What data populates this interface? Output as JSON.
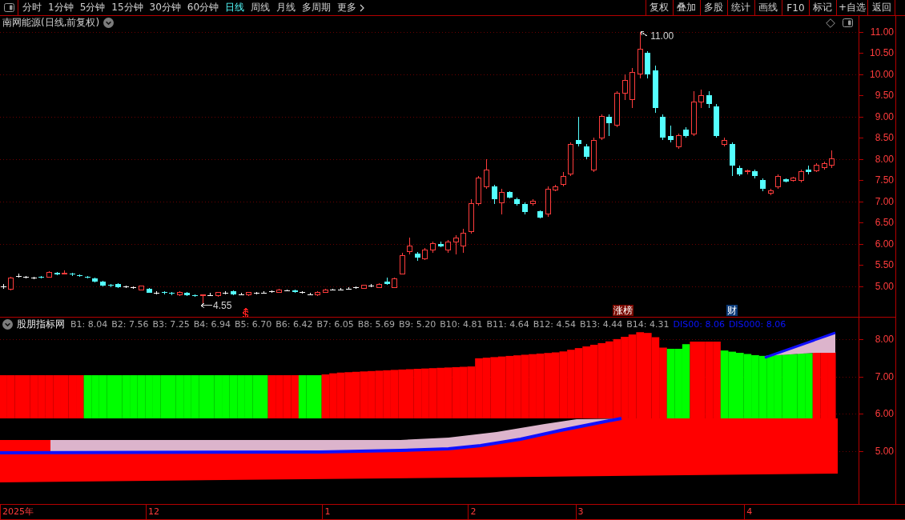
{
  "toolbar": {
    "periods": [
      {
        "label": "分时",
        "selected": false
      },
      {
        "label": "1分钟",
        "selected": false
      },
      {
        "label": "5分钟",
        "selected": false
      },
      {
        "label": "15分钟",
        "selected": false
      },
      {
        "label": "30分钟",
        "selected": false
      },
      {
        "label": "60分钟",
        "selected": false
      },
      {
        "label": "日线",
        "selected": true
      },
      {
        "label": "周线",
        "selected": false
      },
      {
        "label": "月线",
        "selected": false
      },
      {
        "label": "多周期",
        "selected": false
      }
    ],
    "more": "更多",
    "actions": [
      "复权",
      "叠加",
      "多股",
      "统计",
      "画线",
      "F10",
      "标记",
      "+自选",
      "返回"
    ]
  },
  "main_chart": {
    "title": "南网能源(日线,前复权)",
    "high_label": "11.00",
    "low_label": "4.55",
    "event_tags": [
      {
        "text": "涨榜",
        "color": "#7a0a00"
      },
      {
        "text": "财",
        "color": "#0a3a78"
      }
    ],
    "price_axis": [
      "11.00",
      "10.50",
      "10.00",
      "9.50",
      "9.00",
      "8.50",
      "8.00",
      "7.50",
      "7.00",
      "6.50",
      "6.00",
      "5.50",
      "5.00"
    ]
  },
  "indicator": {
    "name": "股朋指标网",
    "legend": [
      {
        "text": "B1: 8.04",
        "color": "#a8a8a8"
      },
      {
        "text": "B2: 7.56",
        "color": "#a8a8a8"
      },
      {
        "text": "B3: 7.25",
        "color": "#a8a8a8"
      },
      {
        "text": "B4: 6.94",
        "color": "#a8a8a8"
      },
      {
        "text": "B5: 6.70",
        "color": "#a8a8a8"
      },
      {
        "text": "B6: 6.42",
        "color": "#a8a8a8"
      },
      {
        "text": "B7: 6.05",
        "color": "#a8a8a8"
      },
      {
        "text": "B8: 5.69",
        "color": "#a8a8a8"
      },
      {
        "text": "B9: 5.20",
        "color": "#a8a8a8"
      },
      {
        "text": "B10: 4.81",
        "color": "#a8a8a8"
      },
      {
        "text": "B11: 4.64",
        "color": "#a8a8a8"
      },
      {
        "text": "B12: 4.54",
        "color": "#a8a8a8"
      },
      {
        "text": "B13: 4.44",
        "color": "#a8a8a8"
      },
      {
        "text": "B14: 4.31",
        "color": "#a8a8a8"
      },
      {
        "text": "DIS00: 8.06",
        "color": "#0a14ff"
      },
      {
        "text": "DIS000: 8.06",
        "color": "#0a14ff"
      }
    ],
    "axis_ticks": [
      "8.00",
      "7.00",
      "6.00",
      "5.00"
    ]
  },
  "date_axis": {
    "labels": [
      "2025年",
      "12",
      "1",
      "2",
      "3",
      "4"
    ]
  }
}
